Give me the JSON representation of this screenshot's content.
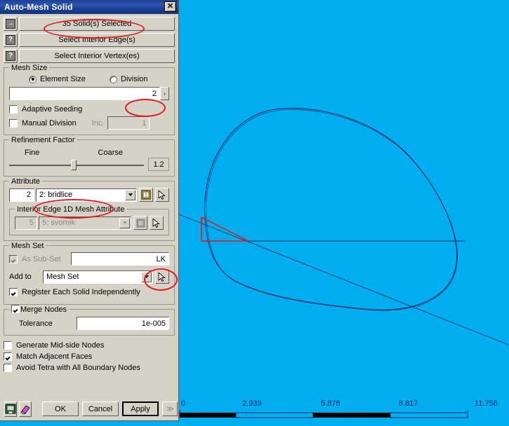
{
  "window": {
    "title": "Auto-Mesh Solid",
    "close_label": "✕"
  },
  "selection": {
    "solids_button": "35 Solid(s) Selected",
    "interior_edges_button": "Select Interior Edge(s)",
    "interior_vertices_button": "Select Interior Vertex(es)",
    "icon_solid": "→",
    "icon_edge": "?",
    "icon_vertex": "?"
  },
  "mesh_size": {
    "legend": "Mesh Size",
    "element_size_label": "Element Size",
    "division_label": "Division",
    "value": "2",
    "spin_label": "›",
    "adaptive_seeding_label": "Adaptive Seeding",
    "manual_division_label": "Manual Division",
    "inc_label": "Inc.",
    "inc_value": "1"
  },
  "refinement": {
    "legend": "Refinement Factor",
    "fine_label": "Fine",
    "coarse_label": "Coarse",
    "value": "1.2"
  },
  "attribute": {
    "legend": "Attribute",
    "id": "2",
    "selected": "2: bridlice",
    "interior_legend": "Interior Edge 1D Mesh  Attribute",
    "interior_id": "5",
    "interior_selected": "5: svornik"
  },
  "mesh_set": {
    "legend": "Mesh Set",
    "as_subset_label": "As Sub-Set",
    "subset_value": "LK",
    "add_to_label": "Add to",
    "add_to_selected": "Mesh Set",
    "register_label": "Register Each Solid Independently"
  },
  "merge": {
    "legend": "Merge Nodes",
    "tolerance_label": "Tolerance",
    "tolerance_value": "1e-005"
  },
  "options": {
    "generate_midside": "Generate Mid-side Nodes",
    "match_adjacent": "Match Adjacent Faces",
    "avoid_tetra": "Avoid Tetra with All Boundary Nodes"
  },
  "footer": {
    "ok": "OK",
    "cancel": "Cancel",
    "apply": "Apply",
    "more": "≫",
    "save_icon": "save-icon",
    "eraser_icon": "eraser-icon"
  },
  "viewport": {
    "background": "#00AEEF",
    "geometry_color": "#16306b",
    "highlight_color": "#e01b24",
    "ruler_labels": [
      "0",
      "2.939",
      "5.878",
      "8.817",
      "11.756"
    ]
  }
}
